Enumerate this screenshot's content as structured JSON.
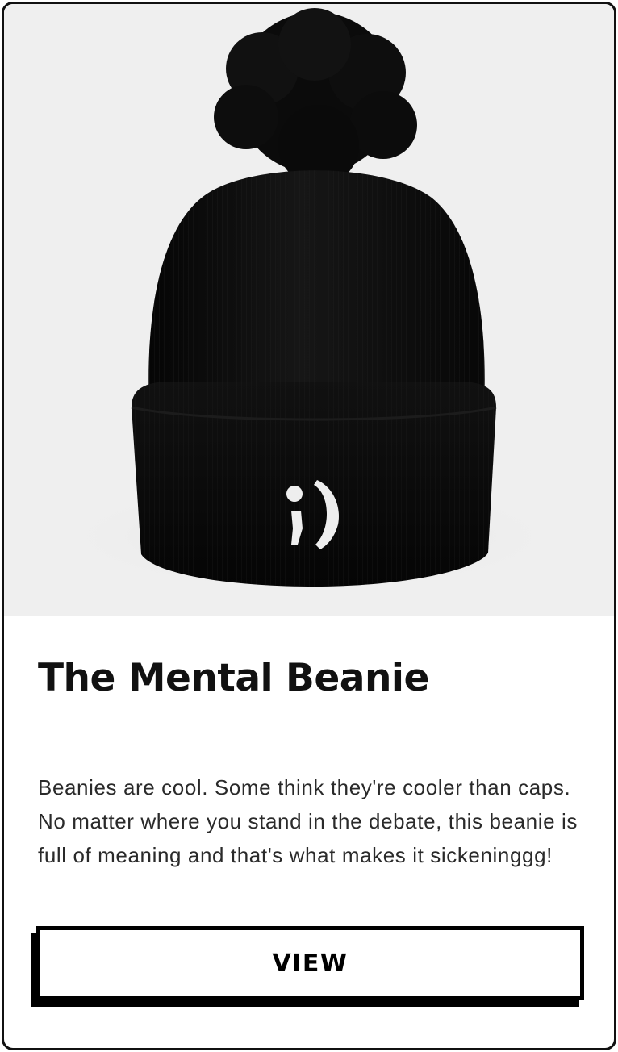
{
  "product": {
    "image_alt": "black pom-pom beanie with embroidered semicolon smile",
    "embroidery": ";)",
    "title": "The Mental Beanie",
    "description": "Beanies are cool. Some think they're cooler than caps. No matter where you stand in the debate, this beanie is full of meaning and that's what makes it sickeninggg!",
    "button_label": "VIEW"
  },
  "colors": {
    "card_border": "#111111",
    "image_background": "#efefef",
    "beanie": "#0d0d0d",
    "embroidery": "#eeeeee",
    "text": "#111111",
    "button_border": "#000000"
  }
}
